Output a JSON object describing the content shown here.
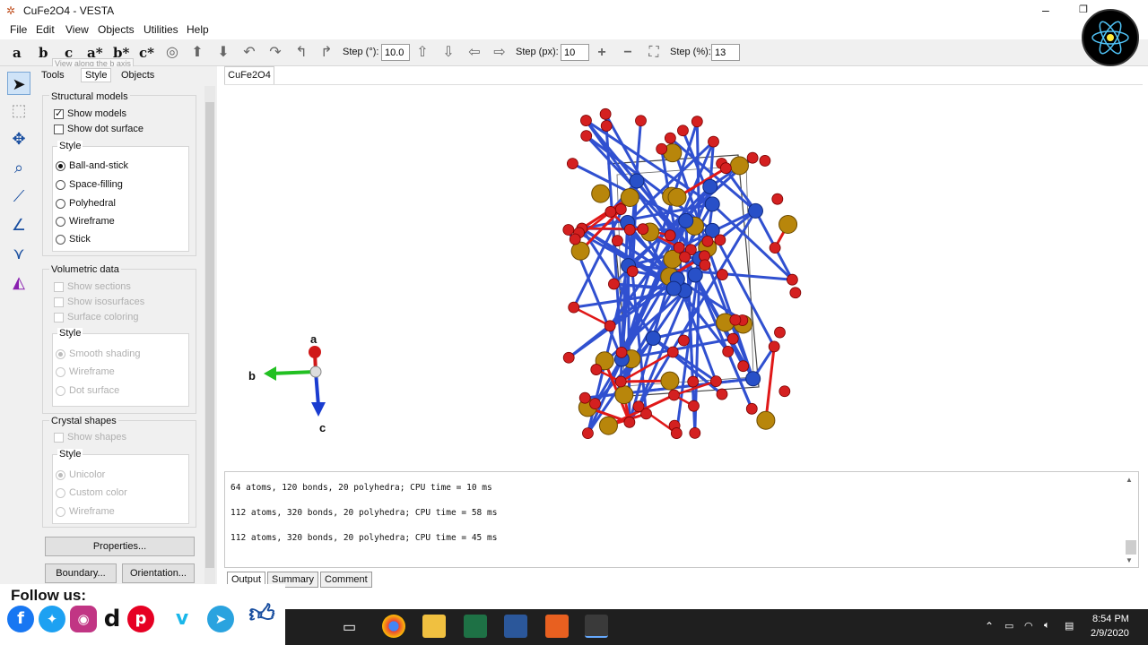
{
  "window": {
    "title": "CuFe2O4 - VESTA"
  },
  "menu": [
    "File",
    "Edit",
    "View",
    "Objects",
    "Utilities",
    "Help"
  ],
  "toolbar": {
    "axes": [
      "a",
      "b",
      "c",
      "a*",
      "b*",
      "c*"
    ],
    "tooltip": "View along the b axis",
    "step_deg_label": "Step (°):",
    "step_deg_value": "10.0",
    "step_px_label": "Step (px):",
    "step_px_value": "10",
    "step_pct_label": "Step (%):",
    "step_pct_value": "13"
  },
  "panel": {
    "tabs": [
      "Tools",
      "Style",
      "Objects"
    ],
    "structural": {
      "title": "Structural models",
      "show_models": "Show models",
      "show_dot_surface": "Show dot surface",
      "style_title": "Style",
      "styles": [
        "Ball-and-stick",
        "Space-filling",
        "Polyhedral",
        "Wireframe",
        "Stick"
      ]
    },
    "volumetric": {
      "title": "Volumetric data",
      "show_sections": "Show sections",
      "show_isosurfaces": "Show isosurfaces",
      "surface_coloring": "Surface coloring",
      "style_title": "Style",
      "styles": [
        "Smooth shading",
        "Wireframe",
        "Dot surface"
      ]
    },
    "crystal": {
      "title": "Crystal shapes",
      "show_shapes": "Show shapes",
      "style_title": "Style",
      "styles": [
        "Unicolor",
        "Custom color",
        "Wireframe"
      ]
    },
    "buttons": {
      "properties": "Properties...",
      "boundary": "Boundary...",
      "orientation": "Orientation..."
    }
  },
  "viewport": {
    "tab": "CuFe2O4",
    "axis_labels": {
      "a": "a",
      "b": "b",
      "c": "c"
    }
  },
  "output": {
    "lines": [
      "64 atoms, 120 bonds, 20 polyhedra; CPU time = 10 ms",
      "112 atoms, 320 bonds, 20 polyhedra; CPU time = 58 ms",
      "112 atoms, 320 bonds, 20 polyhedra; CPU time = 45 ms"
    ],
    "tabs": [
      "Output",
      "Summary",
      "Comment"
    ]
  },
  "overlay": {
    "follow_us": "Follow us:"
  },
  "taskbar": {
    "time": "8:54 PM",
    "date": "2/9/2020"
  },
  "colors": {
    "oxygen": "#d42020",
    "fe": "#b8860b",
    "cu": "#2850c8",
    "bond_red": "#e01818",
    "bond_blue": "#3050d0"
  }
}
